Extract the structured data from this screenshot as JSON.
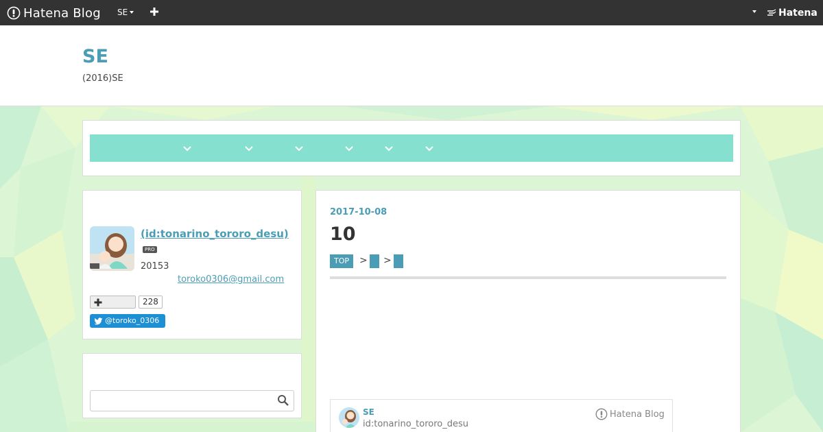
{
  "global_header": {
    "logo_text": "Hatena Blog",
    "blog_select_label": "SE",
    "brand_text": "Hatena"
  },
  "blog": {
    "title": "SE",
    "description": "(2016)SE"
  },
  "profile": {
    "name": " (id:tonarino_tororo_desu)",
    "badge": "PRO",
    "text": "20153",
    "email": "toroko0306@gmail.com",
    "subscribe_count": "228",
    "twitter_label": "@toroko_0306"
  },
  "search": {
    "placeholder": ""
  },
  "entry": {
    "date": "2017-10-08",
    "title": "10",
    "categories": [
      "TOP",
      "",
      ""
    ],
    "separator": ">"
  },
  "blog_card": {
    "title": "SE",
    "id": "id:tonarino_tororo_desu",
    "brand": "Hatena Blog"
  },
  "colors": {
    "header_bg": "#333333",
    "accent": "#4a9db5",
    "nav_bar": "#86e0d0",
    "twitter": "#1d8fd5"
  }
}
